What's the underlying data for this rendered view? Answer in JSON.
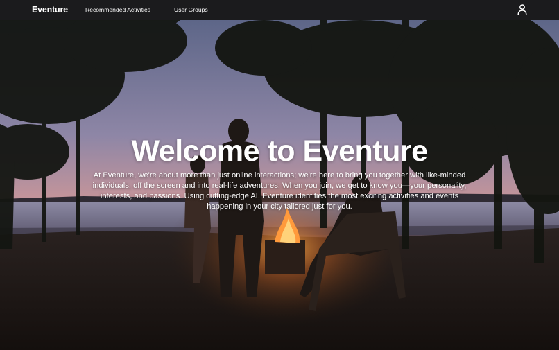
{
  "nav": {
    "brand": "Eventure",
    "links": [
      {
        "label": "Recommended Activities"
      },
      {
        "label": "User Groups"
      }
    ],
    "user_icon": "user-icon"
  },
  "hero": {
    "title": "Welcome to Eventure",
    "description": "At Eventure, we're about more than just online interactions; we're here to bring you together with like-minded individuals, off the screen and into real-life adventures. When you join, we get to know you—your personality, interests, and passions. Using cutting-edge AI, Eventure identifies the most exciting activities and events happening in your city tailored just for you.",
    "background": "campfire-by-lake-photo"
  },
  "colors": {
    "nav_bg": "#1b1b1d",
    "text": "#ffffff",
    "sky_top": "#6f7aa0",
    "sky_glow": "#c98f8c",
    "fire": "#ff9a3c"
  }
}
